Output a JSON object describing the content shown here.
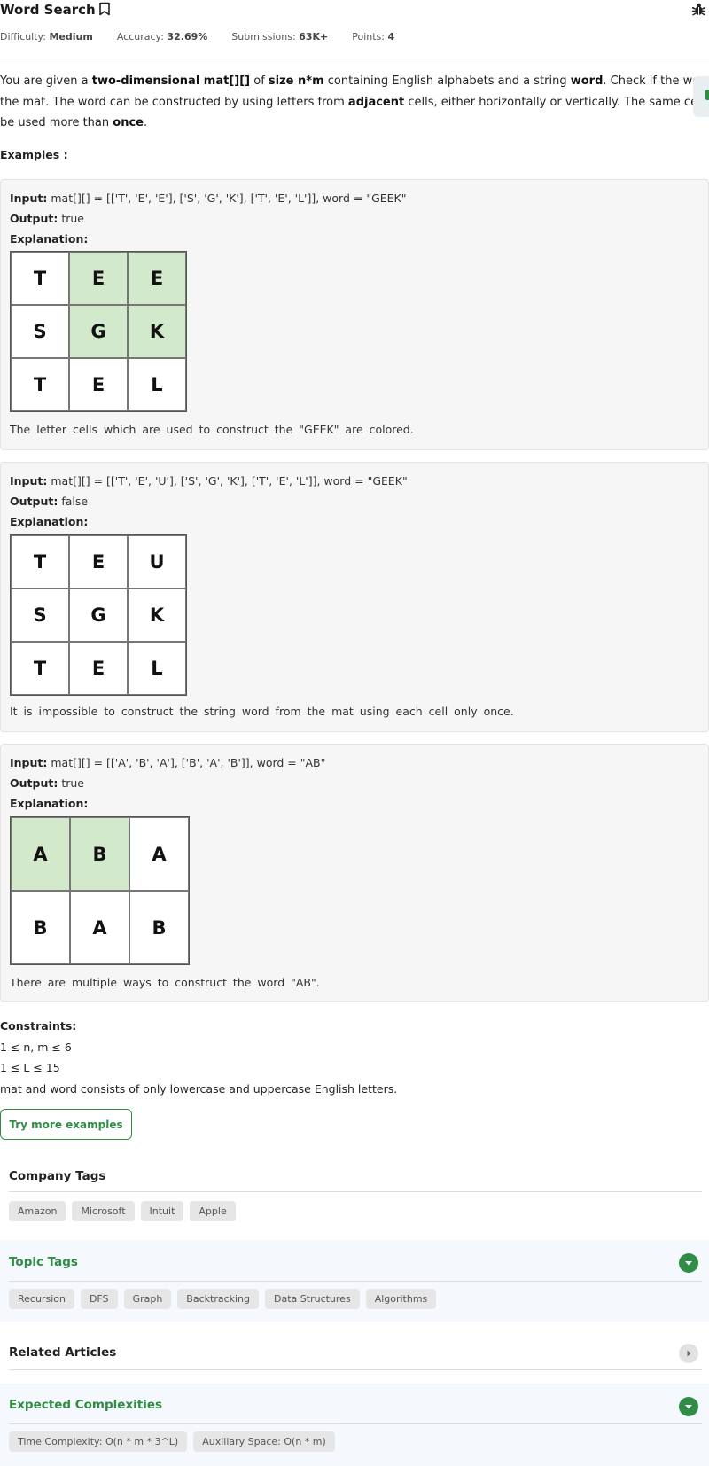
{
  "header": {
    "title": "Word Search",
    "difficulty_label": "Difficulty:",
    "difficulty": "Medium",
    "accuracy_label": "Accuracy:",
    "accuracy": "32.69%",
    "submissions_label": "Submissions:",
    "submissions": "63K+",
    "points_label": "Points:",
    "points": "4"
  },
  "statement": {
    "p1": "You are given a ",
    "b1": "two-dimensional mat[][]",
    "p2": " of ",
    "b2": "size n*m",
    "p3": " containing English alphabets and a string ",
    "b3": "word",
    "p4": ". Check if the word exists on",
    "p5": "the mat. The word can be constructed by using letters from ",
    "b4": "adjacent",
    "p6": " cells, either horizontally or vertically. The same cell cannot",
    "p7": "be used more than ",
    "b5": "once",
    "p8": "."
  },
  "examples_label": "Examples :",
  "examples": [
    {
      "input_label": "Input:",
      "input": "mat[][] = [['T', 'E', 'E'], ['S', 'G', 'K'], ['T', 'E', 'L']], word = \"GEEK\"",
      "output_label": "Output:",
      "output": "true",
      "explanation_label": "Explanation:",
      "grid": [
        [
          "T",
          "E",
          "E"
        ],
        [
          "S",
          "G",
          "K"
        ],
        [
          "T",
          "E",
          "L"
        ]
      ],
      "highlight": [
        [
          false,
          true,
          true
        ],
        [
          false,
          true,
          true
        ],
        [
          false,
          false,
          false
        ]
      ],
      "note": "The letter cells which are used to construct the \"GEEK\" are colored."
    },
    {
      "input_label": "Input:",
      "input": "mat[][] = [['T', 'E', 'U'], ['S', 'G', 'K'], ['T', 'E', 'L']], word = \"GEEK\"",
      "output_label": "Output:",
      "output": "false",
      "explanation_label": "Explanation:",
      "grid": [
        [
          "T",
          "E",
          "U"
        ],
        [
          "S",
          "G",
          "K"
        ],
        [
          "T",
          "E",
          "L"
        ]
      ],
      "highlight": [
        [
          false,
          false,
          false
        ],
        [
          false,
          false,
          false
        ],
        [
          false,
          false,
          false
        ]
      ],
      "note": "It is impossible to construct the string word from the mat using each cell only once."
    },
    {
      "input_label": "Input:",
      "input": "mat[][] = [['A', 'B', 'A'], ['B', 'A', 'B']], word = \"AB\"",
      "output_label": "Output:",
      "output": "true",
      "explanation_label": "Explanation:",
      "grid": [
        [
          "A",
          "B",
          "A"
        ],
        [
          "B",
          "A",
          "B"
        ]
      ],
      "highlight": [
        [
          true,
          true,
          false
        ],
        [
          false,
          false,
          false
        ]
      ],
      "note": "There are multiple ways to construct the word \"AB\"."
    }
  ],
  "constraints": {
    "title": "Constraints:",
    "lines": [
      "1 ≤ n, m ≤ 6",
      "1 ≤ L ≤ 15",
      "mat and word consists of only lowercase and uppercase English letters."
    ]
  },
  "try_button": "Try more examples",
  "company_tags": {
    "title": "Company Tags",
    "tags": [
      "Amazon",
      "Microsoft",
      "Intuit",
      "Apple"
    ]
  },
  "topic_tags": {
    "title": "Topic Tags",
    "tags": [
      "Recursion",
      "DFS",
      "Graph",
      "Backtracking",
      "Data Structures",
      "Algorithms"
    ]
  },
  "related_articles": {
    "title": "Related Articles"
  },
  "complexities": {
    "title": "Expected Complexities",
    "tags": [
      "Time Complexity: O(n * m * 3^L)",
      "Auxiliary Space: O(n * m)"
    ]
  },
  "colors": {
    "accent": "#2f8d46",
    "highlight_cell": "#d3e9cc",
    "example_bg": "#f6f6f6"
  },
  "icons": {
    "bookmark": "bookmark-icon",
    "bug": "bug-icon",
    "expand": "chevron-down-icon",
    "collapsed": "caret-right-icon"
  }
}
